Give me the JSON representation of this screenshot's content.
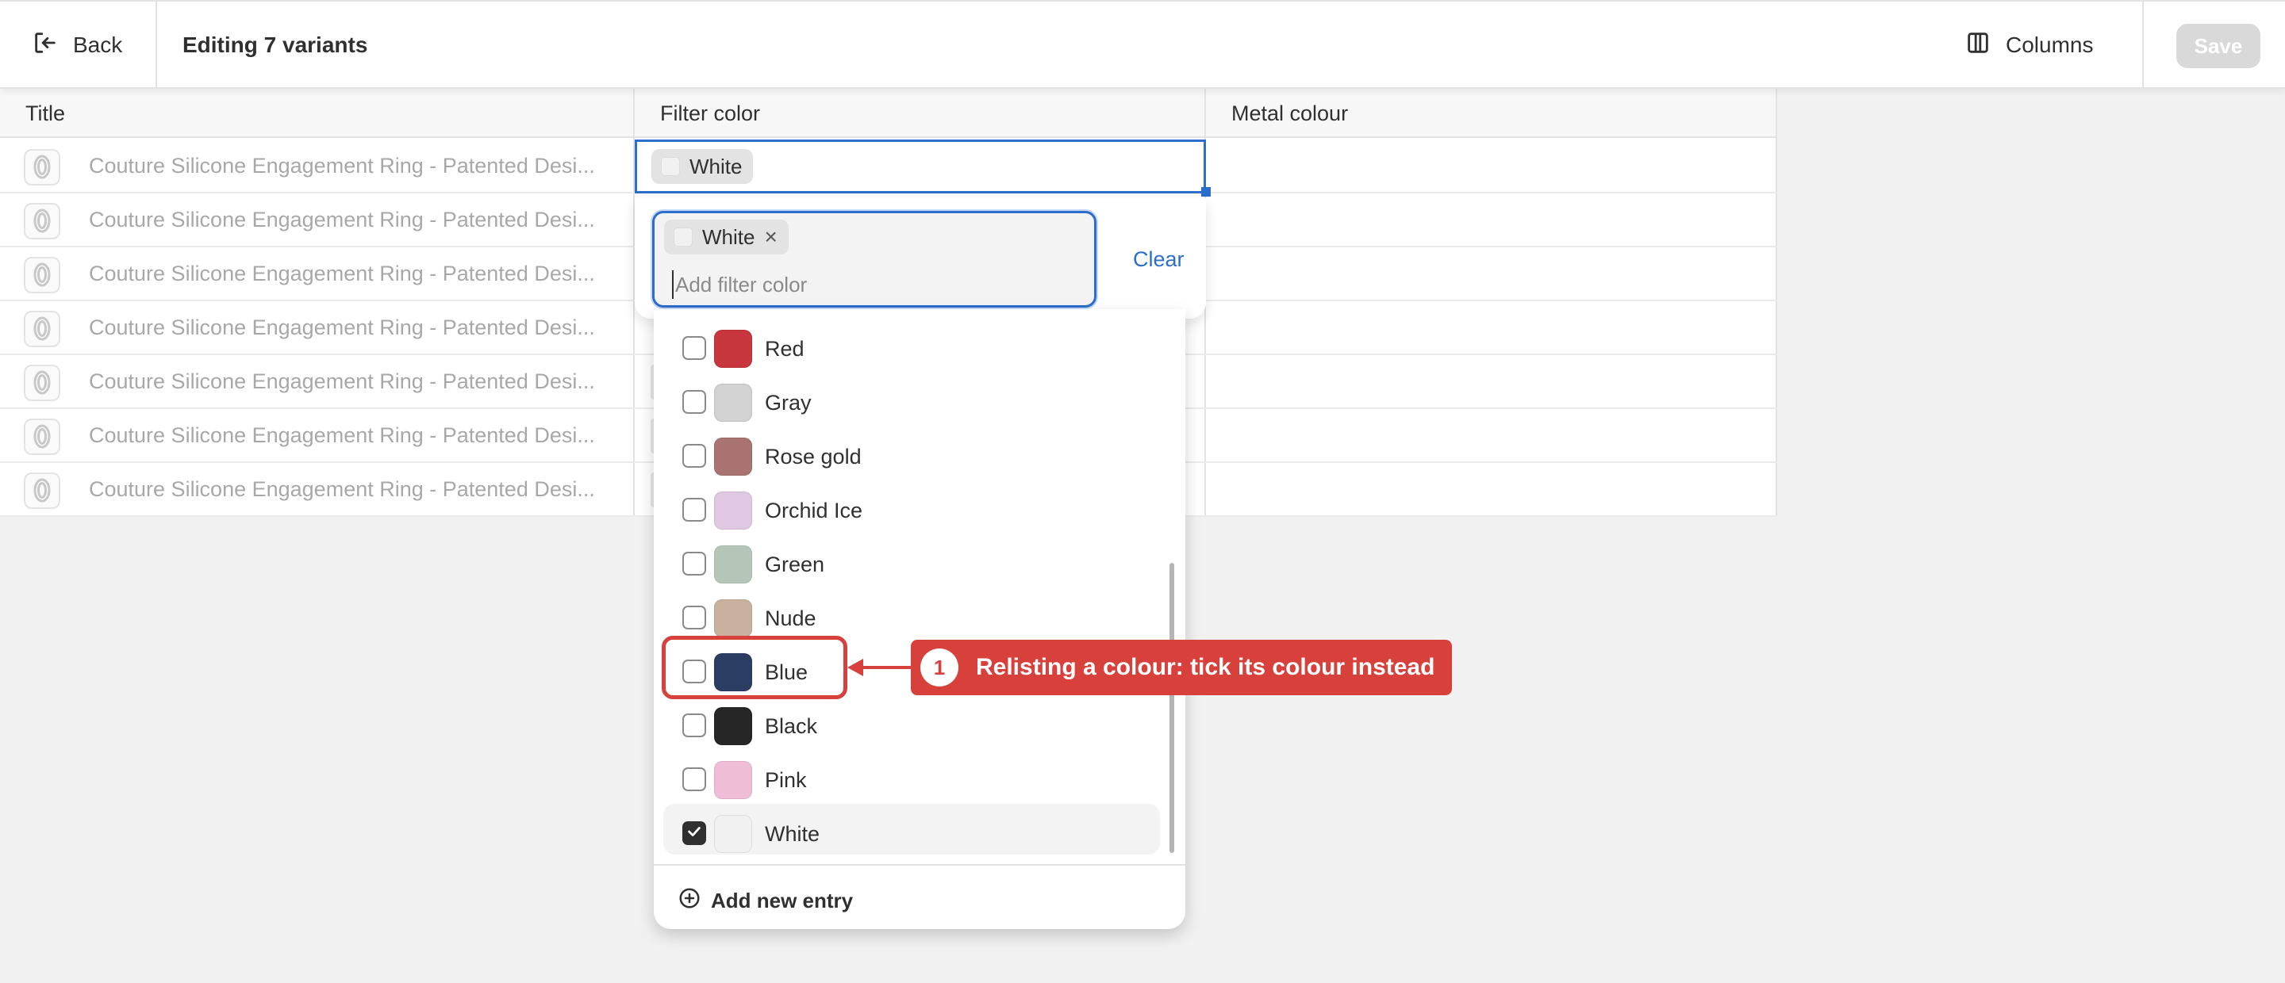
{
  "topbar": {
    "back_label": "Back",
    "title": "Editing 7 variants",
    "columns_label": "Columns",
    "save_label": "Save"
  },
  "grid": {
    "columns": [
      "Title",
      "Filter color",
      "Metal colour"
    ],
    "rows": [
      {
        "title": "Couture Silicone Engagement Ring - Patented Desi..."
      },
      {
        "title": "Couture Silicone Engagement Ring - Patented Desi..."
      },
      {
        "title": "Couture Silicone Engagement Ring - Patented Desi..."
      },
      {
        "title": "Couture Silicone Engagement Ring - Patented Desi..."
      },
      {
        "title": "Couture Silicone Engagement Ring - Patented Desi..."
      },
      {
        "title": "Couture Silicone Engagement Ring - Patented Desi..."
      },
      {
        "title": "Couture Silicone Engagement Ring - Patented Desi..."
      }
    ],
    "active_cell_tag": "White"
  },
  "popover": {
    "selected_tag": "White",
    "input_placeholder": "Add filter color",
    "clear_label": "Clear"
  },
  "dropdown": {
    "options": [
      {
        "label": "Red",
        "color": "#c7353d",
        "checked": false
      },
      {
        "label": "Gray",
        "color": "#d2d2d2",
        "checked": false
      },
      {
        "label": "Rose gold",
        "color": "#a87372",
        "checked": false
      },
      {
        "label": "Orchid Ice",
        "color": "#e1c8e2",
        "checked": false
      },
      {
        "label": "Green",
        "color": "#b5c6b8",
        "checked": false
      },
      {
        "label": "Nude",
        "color": "#c9b09f",
        "checked": false
      },
      {
        "label": "Blue",
        "color": "#2c3d63",
        "checked": false
      },
      {
        "label": "Black",
        "color": "#262626",
        "checked": false
      },
      {
        "label": "Pink",
        "color": "#efbdd5",
        "checked": false
      },
      {
        "label": "White",
        "color": "#f1f1f1",
        "checked": true
      }
    ],
    "add_entry_label": "Add new entry"
  },
  "annotation": {
    "number": "1",
    "text": "Relisting a colour: tick its colour instead",
    "color": "#d8413b"
  },
  "colors": {
    "accent": "#2c6ecb",
    "white_swatch": "#f1f1f1"
  }
}
